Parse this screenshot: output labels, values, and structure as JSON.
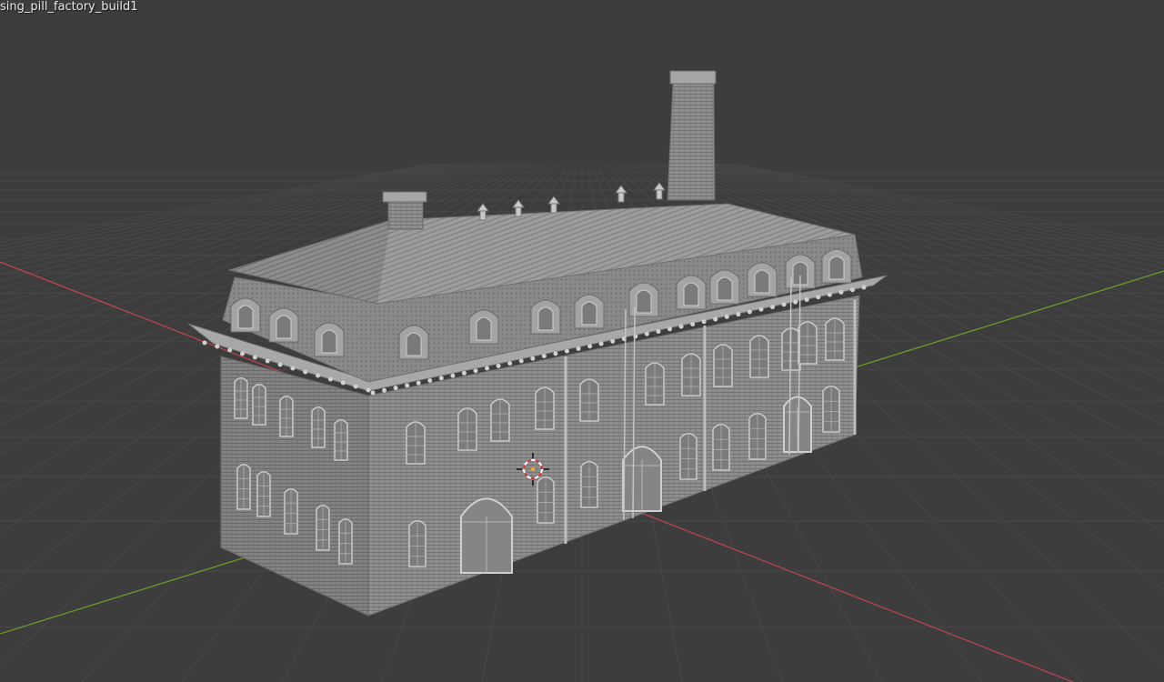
{
  "viewport": {
    "object_name": "sing_pill_factory_build1",
    "background_color": "#3d3d3d",
    "grid_color": "#474747",
    "x_axis_color": "#b8444f",
    "y_axis_color": "#6b9a2c",
    "model_color": "#9a9a9a",
    "cursor_icon": "3d-cursor-icon"
  }
}
